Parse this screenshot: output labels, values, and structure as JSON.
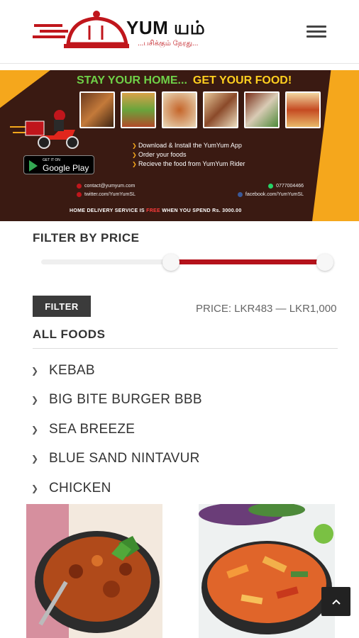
{
  "header": {
    "brand": "YUM யம்",
    "tagline": "...பசிக்கும் நேரது...",
    "menu_icon": "hamburger-icon"
  },
  "banner": {
    "headline_1": "STAY YOUR HOME...",
    "headline_2": "GET YOUR FOOD!",
    "steps": [
      "Download & Install the YumYum App",
      "Order your foods",
      "Recieve the food from YumYum Rider"
    ],
    "store_small": "GET IT ON",
    "store_big": "Google Play",
    "contact_email": "contact@yumyum.com",
    "contact_phone": "0777004466",
    "contact_twitter": "twitter.com/YumYumSL",
    "contact_facebook": "facebook.com/YumYumSL",
    "delivery_1": "HOME DELIVERY SERVICE IS ",
    "delivery_free": "FREE",
    "delivery_2": " WHEN YOU SPEND Rs. 3000.00",
    "mini_brand": "YUM யம்"
  },
  "filter": {
    "title": "FILTER BY PRICE",
    "min_fraction": 0.44,
    "max_fraction": 1.0,
    "button_label": "FILTER",
    "price_text": "PRICE: LKR483 — LKR1,000"
  },
  "categories": {
    "title": "ALL FOODS",
    "items": [
      "KEBAB",
      "BIG BITE BURGER BBB",
      "SEA BREEZE",
      "BLUE SAND NINTAVUR",
      "CHICKEN"
    ]
  },
  "colors": {
    "accent": "#b5121b",
    "brand_red": "#c0161c",
    "banner_orange": "#f5a71c",
    "banner_dark": "#3a1a12"
  }
}
